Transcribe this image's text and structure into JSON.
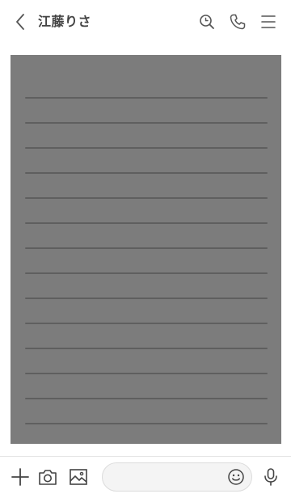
{
  "header": {
    "title": "江藤りさ",
    "back_icon": "chevron-left-icon",
    "search_icon": "search-icon",
    "call_icon": "phone-icon",
    "menu_icon": "hamburger-menu-icon"
  },
  "chat": {
    "note_panel_color": "#7c7c7c",
    "line_color": "#5f5f5f",
    "line_count": 14
  },
  "bottom_bar": {
    "plus_icon": "plus-icon",
    "camera_icon": "camera-icon",
    "image_icon": "image-icon",
    "input_placeholder": "",
    "emoji_icon": "emoji-icon",
    "mic_icon": "microphone-icon"
  },
  "colors": {
    "icon": "#555555",
    "title": "#444444",
    "background": "#ffffff"
  }
}
